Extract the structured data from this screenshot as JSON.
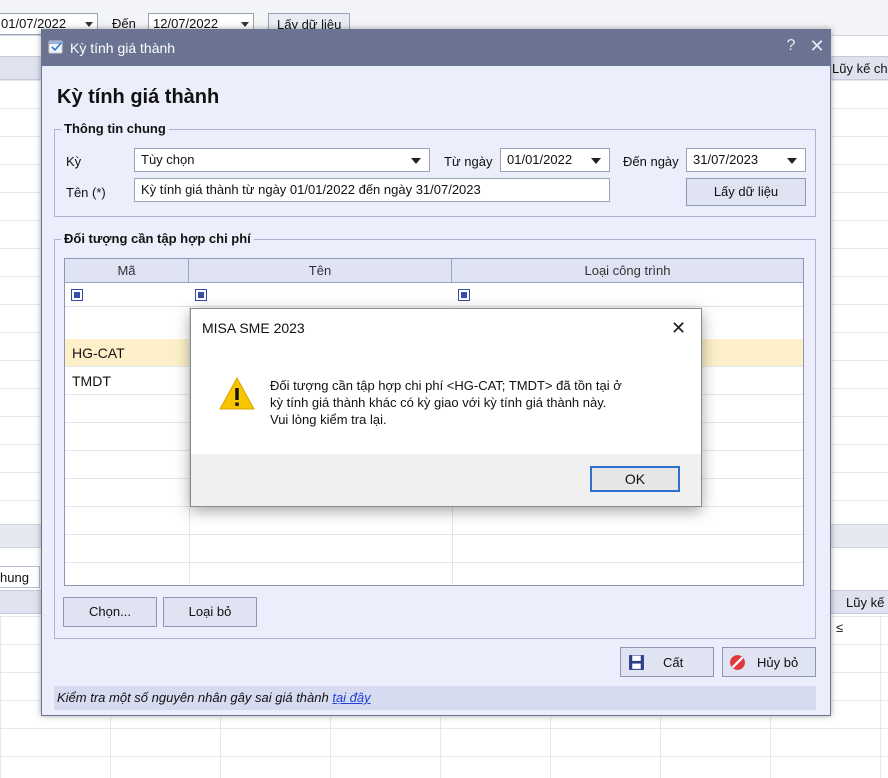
{
  "background": {
    "from_date": "01/07/2022",
    "to_label": "Đến",
    "to_date": "12/07/2022",
    "get_data_button": "Lấy dữ liệu",
    "header_right": "Lũy kế ch",
    "tab_label": "hung",
    "header_right_2": "Lũy kế",
    "le_symbol": "≤"
  },
  "dialog": {
    "window_title": "Kỳ tính giá thành",
    "help_glyph": "?",
    "close_glyph": "✕",
    "heading": "Kỳ tính giá thành",
    "general_group": {
      "title": "Thông tin chung",
      "period_label": "Kỳ",
      "period_value": "Tùy chọn",
      "from_label": "Từ ngày",
      "from_value": "01/01/2022",
      "to_label": "Đến ngày",
      "to_value": "31/07/2023",
      "name_label": "Tên (*)",
      "name_value": "Kỳ tính giá thành từ ngày 01/01/2022 đến ngày 31/07/2023",
      "get_data_button": "Lấy dữ liệu"
    },
    "objects_group": {
      "title": "Đối tượng cần tập hợp chi phí",
      "columns": [
        "Mã",
        "Tên",
        "Loại công trình"
      ],
      "rows": [
        {
          "code": "HG-CAT",
          "name": "",
          "type": "",
          "selected": true
        },
        {
          "code": "TMDT",
          "name": "",
          "type": "",
          "selected": false
        }
      ],
      "choose_button": "Chọn...",
      "remove_button": "Loại bỏ"
    },
    "save_button": "Cất",
    "cancel_button": "Hủy bỏ",
    "footer_text": "Kiểm tra một số nguyên nhân gây sai giá thành ",
    "footer_link": "tại đây"
  },
  "message_box": {
    "title": "MISA SME 2023",
    "close_glyph": "✕",
    "lines": [
      "Đối tượng cần tập hợp chi phí <HG-CAT; TMDT> đã tồn tại ở",
      "kỳ tính giá thành khác có kỳ giao với kỳ tính giá thành này.",
      "Vui lòng kiểm tra lại."
    ],
    "ok_button": "OK",
    "icon": "warning-icon"
  },
  "colors": {
    "titlebar": "#6a7392",
    "dialog_bg": "#eceefb",
    "selected_row": "#fdf0c8",
    "warning_yellow": "#f7c400",
    "link": "#1e3fd6"
  }
}
